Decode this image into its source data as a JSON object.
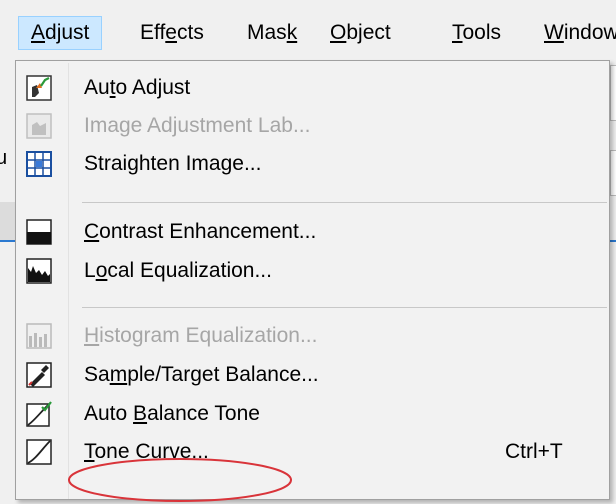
{
  "menubar": {
    "items": [
      {
        "pre": "",
        "ul": "A",
        "post": "djust"
      },
      {
        "pre": "Eff",
        "ul": "e",
        "post": "cts"
      },
      {
        "pre": "Mas",
        "ul": "k",
        "post": ""
      },
      {
        "pre": "",
        "ul": "O",
        "post": "bject"
      },
      {
        "pre": "",
        "ul": "T",
        "post": "ools"
      },
      {
        "pre": "",
        "ul": "W",
        "post": "indow"
      }
    ]
  },
  "adjust_menu": {
    "items": [
      {
        "pre": "Au",
        "ul": "t",
        "post": "o Adjust",
        "icon": "auto-adjust-icon",
        "enabled": true
      },
      {
        "pre": "Image Adjustment Lab...",
        "ul": "",
        "post": "",
        "icon": "image-adjustment-lab-icon",
        "enabled": false
      },
      {
        "pre": "Strai",
        "ul": "g",
        "post": "hten Image...",
        "icon": "straighten-image-icon",
        "enabled": true
      },
      {
        "pre": "",
        "ul": "C",
        "post": "ontrast Enhancement...",
        "icon": "contrast-enhancement-icon",
        "enabled": true
      },
      {
        "pre": "L",
        "ul": "o",
        "post": "cal Equalization...",
        "icon": "local-equalization-icon",
        "enabled": true
      },
      {
        "pre": "",
        "ul": "H",
        "post": "istogram Equalization...",
        "icon": "histogram-equalization-icon",
        "enabled": false
      },
      {
        "pre": "Sa",
        "ul": "m",
        "post": "ple/Target Balance...",
        "icon": "sample-target-balance-icon",
        "enabled": true
      },
      {
        "pre": "Auto ",
        "ul": "B",
        "post": "alance Tone",
        "icon": "auto-balance-tone-icon",
        "enabled": true
      },
      {
        "pre": "",
        "ul": "T",
        "post": "one Curve...",
        "icon": "tone-curve-icon",
        "enabled": true,
        "shortcut": "Ctrl+T"
      }
    ]
  },
  "colors": {
    "menu_bg": "#f2f2f2",
    "active_menu_bg": "#cce8ff",
    "disabled_text": "#a6a6a6",
    "annotation_ellipse": "#d9343a"
  }
}
